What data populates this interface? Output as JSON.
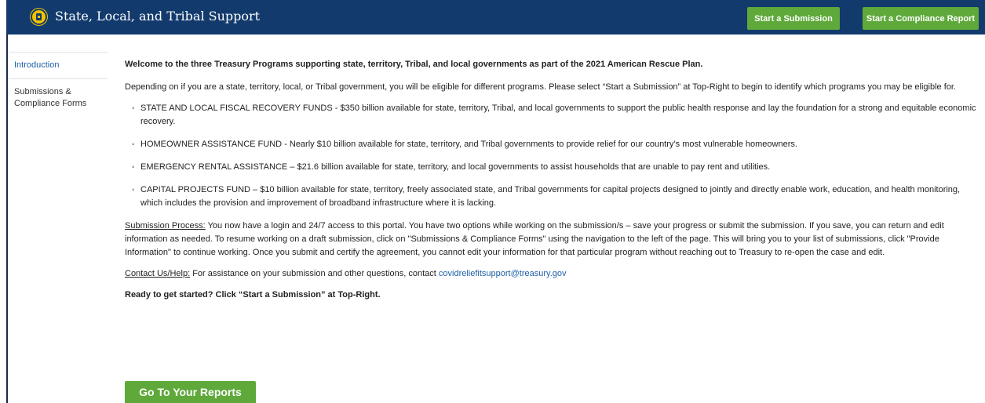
{
  "header": {
    "title": "State, Local, and Tribal Support",
    "logo_icon": "treasury-seal-icon",
    "start_submission_label": "Start a Submission",
    "start_compliance_label": "Start a Compliance Report",
    "bg_color": "#123a6d",
    "button_color": "#5ea93a"
  },
  "sidebar": {
    "items": [
      {
        "label": "Introduction",
        "active": true
      },
      {
        "label": "Submissions & Compliance Forms",
        "active": false
      }
    ]
  },
  "main": {
    "welcome": "Welcome to the three Treasury Programs supporting state, territory, Tribal, and local governments as part of the 2021 American Rescue Plan.",
    "intro": "Depending on if you are a state, territory, local, or Tribal government, you will be eligible for different programs. Please select “Start a Submission” at Top-Right to begin to identify which programs you may be eligible for.",
    "programs": [
      {
        "name": "STATE AND LOCAL FISCAL RECOVERY FUNDS",
        "desc": " - $350 billion available for state, territory, Tribal, and local governments to support the public health response and lay the foundation for a strong and equitable economic recovery."
      },
      {
        "name": "HOMEOWNER ASSISTANCE FUND",
        "desc": " - Nearly $10 billion available for state, territory, and Tribal governments to provide relief for our country’s most vulnerable homeowners."
      },
      {
        "name": "EMERGENCY RENTAL ASSISTANCE",
        "desc": " – $21.6 billion available for state, territory, and local governments to assist households that are unable to pay rent and utilities."
      },
      {
        "name": "CAPITAL PROJECTS FUND",
        "desc": " – $10 billion available for state, territory, freely associated state, and Tribal governments for capital projects designed to jointly and directly enable work, education, and health monitoring, which includes the provision and improvement of broadband infrastructure where it is lacking."
      }
    ],
    "submission_label": "Submission Process:",
    "submission_text": " You now have a login and 24/7 access to this portal. You have two options while working on the submission/s – save your progress or submit the submission. If you save, you can return and edit information as needed. To resume working on a draft submission, click on \"Submissions & Compliance Forms\" using the navigation to the left of the page. This will bring you to your list of submissions, click \"Provide Information\" to continue working. Once you submit and certify the agreement, you cannot edit your information for that particular program without reaching out to Treasury to re-open the case and edit.",
    "contact_label": "Contact Us/Help:",
    "contact_text": " For assistance on your submission and other questions, contact ",
    "contact_email": "covidreliefitsupport@treasury.gov",
    "ready_text": "Ready to get started? Click “Start a Submission” at Top-Right.",
    "go_reports_label": "Go To Your Reports"
  }
}
